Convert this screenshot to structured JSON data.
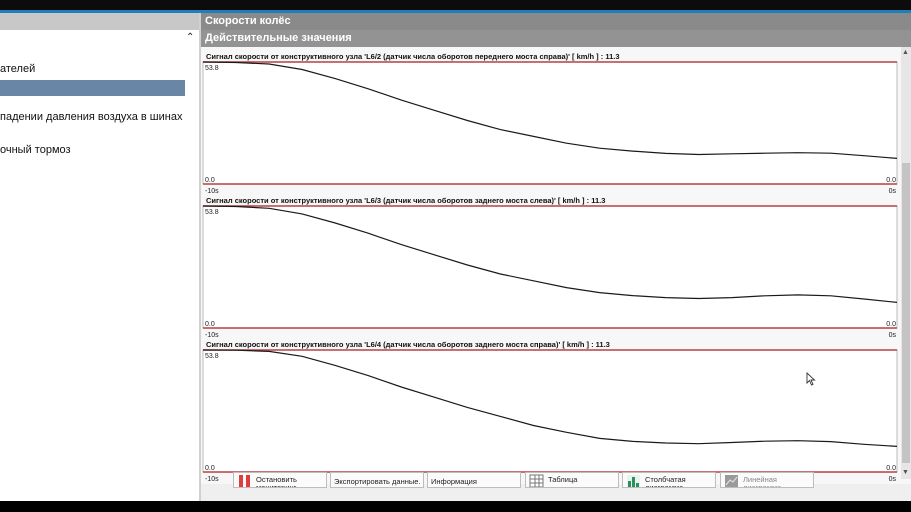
{
  "left_panel": {
    "items": [
      {
        "label": "ателей",
        "selected": false
      },
      {
        "label": "",
        "selected": true
      },
      {
        "label": "падении давления воздуха в шинах",
        "selected": false
      },
      {
        "label": "очный тормоз",
        "selected": false
      }
    ]
  },
  "header": {
    "title": "Скорости колёс",
    "subtitle": "Действительные значения"
  },
  "plots": [
    {
      "title": "Сигнал скорости от конструктивного узла 'L6/2 (датчик числа оборотов переднего моста справа)' [ km/h ] : 11.3",
      "y_max": "53.8",
      "y_min": "0.0",
      "right_value": "0.0",
      "x_start": "-10s",
      "x_end": "0s",
      "points": [
        [
          0,
          53.8
        ],
        [
          1,
          53.6
        ],
        [
          2,
          52.9
        ],
        [
          3,
          50.5
        ],
        [
          4,
          46.5
        ],
        [
          5,
          42.0
        ],
        [
          6,
          37.0
        ],
        [
          7,
          32.5
        ],
        [
          8,
          28.0
        ],
        [
          9,
          24.0
        ],
        [
          10,
          21.0
        ],
        [
          11,
          18.0
        ],
        [
          12,
          15.8
        ],
        [
          13,
          14.5
        ],
        [
          14,
          13.5
        ],
        [
          15,
          13.0
        ],
        [
          16,
          13.3
        ],
        [
          17,
          13.6
        ],
        [
          18,
          13.8
        ],
        [
          19,
          13.6
        ],
        [
          20,
          12.5
        ],
        [
          21,
          11.3
        ]
      ]
    },
    {
      "title": "Сигнал скорости от конструктивного узла 'L6/3 (датчик числа оборотов заднего моста слева)' [ km/h ] : 11.3",
      "y_max": "53.8",
      "y_min": "0.0",
      "right_value": "0.0",
      "x_start": "-10s",
      "x_end": "0s",
      "points": [
        [
          0,
          53.8
        ],
        [
          1,
          53.6
        ],
        [
          2,
          52.8
        ],
        [
          3,
          50.3
        ],
        [
          4,
          46.3
        ],
        [
          5,
          41.8
        ],
        [
          6,
          36.8
        ],
        [
          7,
          32.3
        ],
        [
          8,
          27.8
        ],
        [
          9,
          23.8
        ],
        [
          10,
          20.8
        ],
        [
          11,
          17.8
        ],
        [
          12,
          15.6
        ],
        [
          13,
          14.3
        ],
        [
          14,
          13.4
        ],
        [
          15,
          13.0
        ],
        [
          16,
          13.4
        ],
        [
          17,
          14.2
        ],
        [
          18,
          14.6
        ],
        [
          19,
          14.2
        ],
        [
          20,
          12.8
        ],
        [
          21,
          11.3
        ]
      ]
    },
    {
      "title": "Сигнал скорости от конструктивного узла 'L6/4 (датчик числа оборотов заднего моста справа)' [ km/h ] : 11.3",
      "y_max": "53.8",
      "y_min": "0.0",
      "right_value": "0.0",
      "x_start": "-10s",
      "x_end": "0s",
      "points": [
        [
          0,
          53.8
        ],
        [
          1,
          53.7
        ],
        [
          2,
          53.2
        ],
        [
          3,
          51.0
        ],
        [
          4,
          47.0
        ],
        [
          5,
          42.5
        ],
        [
          6,
          37.5
        ],
        [
          7,
          33.0
        ],
        [
          8,
          28.5
        ],
        [
          9,
          24.5
        ],
        [
          10,
          20.5
        ],
        [
          11,
          17.5
        ],
        [
          12,
          14.8
        ],
        [
          13,
          13.5
        ],
        [
          14,
          12.8
        ],
        [
          15,
          12.5
        ],
        [
          16,
          13.0
        ],
        [
          17,
          13.6
        ],
        [
          18,
          13.8
        ],
        [
          19,
          13.4
        ],
        [
          20,
          12.2
        ],
        [
          21,
          11.3
        ]
      ]
    }
  ],
  "toolbar": {
    "stop_label": "Остановить мониторинг",
    "export_label": "Экспортировать данные.",
    "info_label": "Информация",
    "table_label": "Таблица",
    "bar_label": "Столбчатая диаграмма",
    "line_label": "Линейная диаграмма"
  },
  "colors": {
    "accent": "#1f7fb8",
    "header_bg": "#8a8a8a",
    "selected_bg": "#6a86a6",
    "limit_line": "#b8403e",
    "curve": "#1a1a1a"
  },
  "icons": [
    "stop-icon",
    "table-icon",
    "bar-chart-icon",
    "line-chart-icon",
    "mouse-cursor-icon"
  ]
}
